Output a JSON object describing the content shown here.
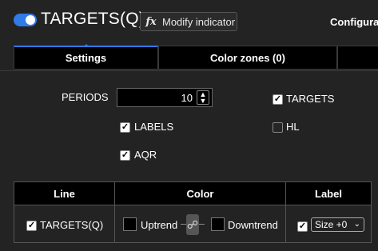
{
  "header": {
    "title": "TARGETS(Q)",
    "modify_label": "Modify indicator",
    "fx_symbol": "fx",
    "config_label": "Configura",
    "toggle_on": true,
    "accent": "#2f7be8"
  },
  "tabs": [
    {
      "label": "Settings",
      "active": true
    },
    {
      "label": "Color zones (0)",
      "active": false
    }
  ],
  "settings": {
    "periods_label": "PERIODS",
    "periods_value": "10",
    "targets_label": "TARGETS",
    "targets_checked": true,
    "labels_label": "LABELS",
    "labels_checked": true,
    "hl_label": "HL",
    "hl_checked": false,
    "aqr_label": "AQR",
    "aqr_checked": true
  },
  "table": {
    "headers": [
      "Line",
      "Color",
      "Label"
    ],
    "row": {
      "line_label": "TARGETS(Q)",
      "line_checked": true,
      "uptrend_label": "Uptrend",
      "downtrend_label": "Downtrend",
      "label_checked": true,
      "size_value": "Size +0"
    }
  }
}
